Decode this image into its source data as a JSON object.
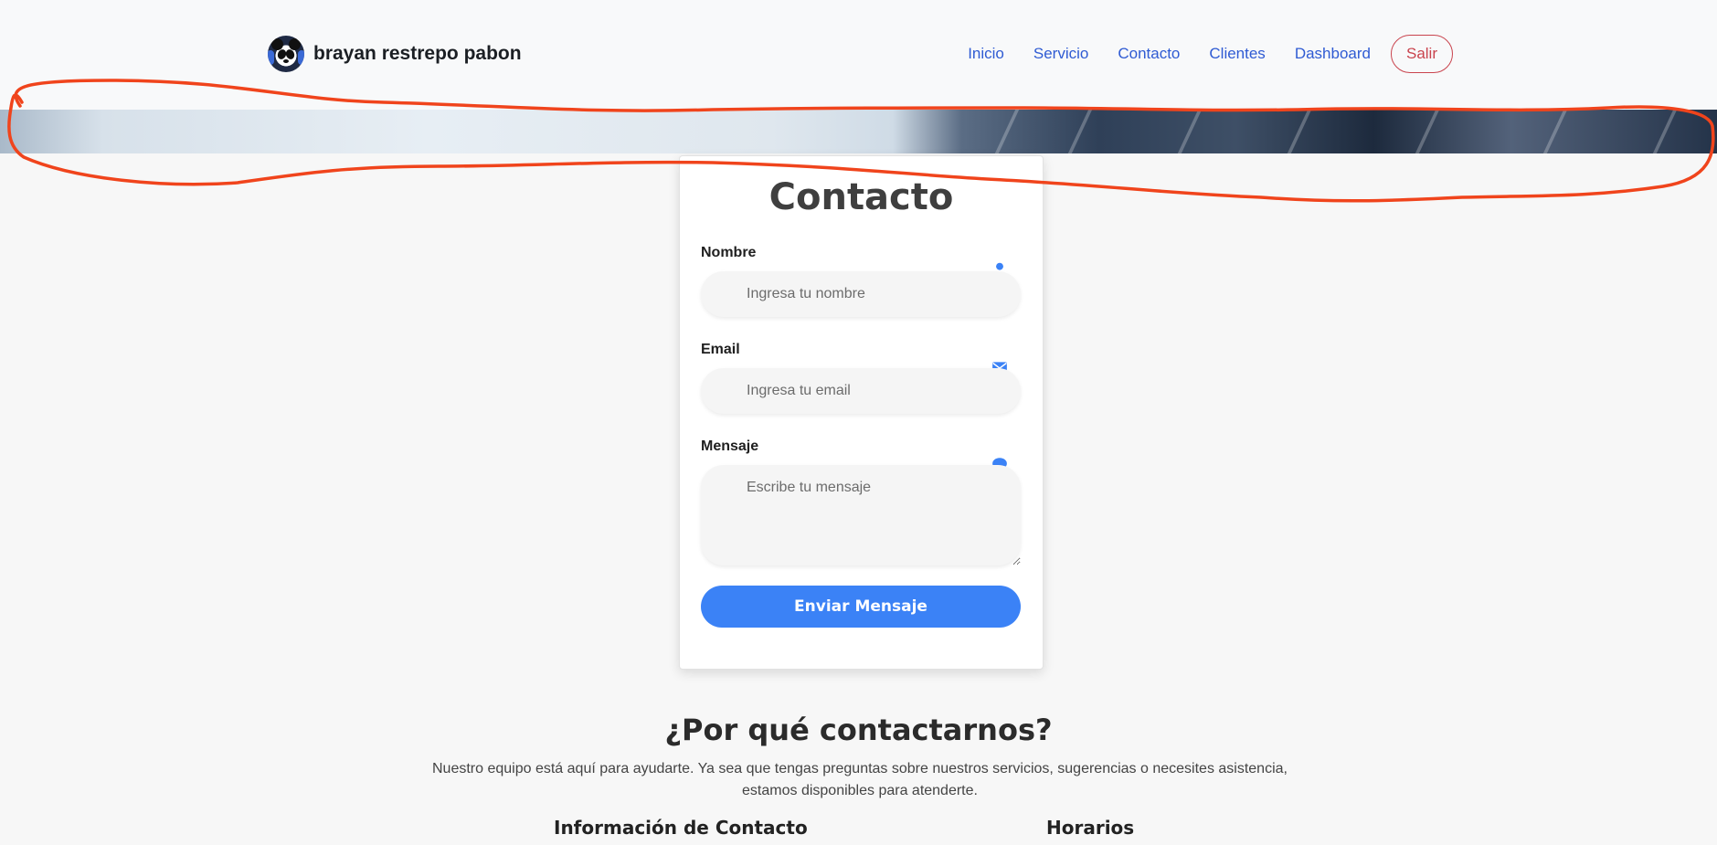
{
  "brand": {
    "name": "brayan restrepo pabon",
    "logo_icon": "panda-icon"
  },
  "nav": {
    "links": [
      {
        "label": "Inicio"
      },
      {
        "label": "Servicio"
      },
      {
        "label": "Contacto"
      },
      {
        "label": "Clientes"
      },
      {
        "label": "Dashboard"
      }
    ],
    "logout_label": "Salir",
    "link_color": "#2f5bd3",
    "logout_color": "#c9434d"
  },
  "form": {
    "title": "Contacto",
    "name": {
      "label": "Nombre",
      "placeholder": "Ingresa tu nombre",
      "icon": "user-icon"
    },
    "email": {
      "label": "Email",
      "placeholder": "Ingresa tu email",
      "icon": "envelope-icon"
    },
    "message": {
      "label": "Mensaje",
      "placeholder": "Escribe tu mensaje",
      "icon": "comment-icon"
    },
    "submit_label": "Enviar Mensaje",
    "accent_color": "#3b82f6"
  },
  "why": {
    "title": "¿Por qué contactarnos?",
    "text_line1": "Nuestro equipo está aquí para ayudarte. Ya sea que tengas preguntas sobre nuestros servicios, sugerencias o necesites asistencia,",
    "text_line2": "estamos disponibles para atenderte.",
    "info_title": "Información de Contacto",
    "hours_title": "Horarios"
  },
  "annotation": {
    "color": "#f0441c"
  }
}
